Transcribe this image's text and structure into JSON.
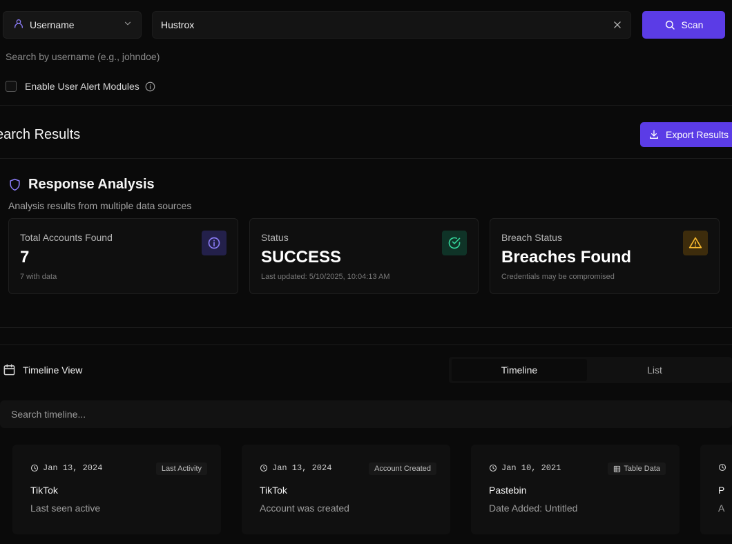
{
  "search": {
    "type_label": "Username",
    "value": "Hustrox",
    "scan_label": "Scan",
    "helper": "Search by username (e.g., johndoe)",
    "alert_label": "Enable User Alert Modules"
  },
  "results": {
    "title": "earch Results",
    "export_label": "Export Results"
  },
  "analysis": {
    "title": "Response Analysis",
    "subtitle": "Analysis results from multiple data sources",
    "cards": [
      {
        "label": "Total Accounts Found",
        "value": "7",
        "sub": "7 with data",
        "icon": "info-icon",
        "color": "#8b7cf6"
      },
      {
        "label": "Status",
        "value": "SUCCESS",
        "sub": "Last updated: 5/10/2025, 10:04:13 AM",
        "icon": "check-circle-icon",
        "color": "#34d399"
      },
      {
        "label": "Breach Status",
        "value": "Breaches Found",
        "sub": "Credentials may be compromised",
        "icon": "warning-icon",
        "color": "#f5b82e"
      }
    ]
  },
  "timeline": {
    "title": "Timeline View",
    "tabs": [
      {
        "label": "Timeline"
      },
      {
        "label": "List"
      }
    ],
    "search_placeholder": "Search timeline...",
    "events": [
      {
        "date": "Jan 13, 2024",
        "tag": "Last Activity",
        "source": "TikTok",
        "desc": "Last seen active"
      },
      {
        "date": "Jan 13, 2024",
        "tag": "Account Created",
        "source": "TikTok",
        "desc": "Account was created"
      },
      {
        "date": "Jan 10, 2021",
        "tag": "Table Data",
        "source": "Pastebin",
        "desc": "Date Added: Untitled"
      },
      {
        "date": "",
        "tag": "",
        "source": "P",
        "desc": "A"
      }
    ]
  },
  "colors": {
    "accent": "#5b3ce6"
  }
}
